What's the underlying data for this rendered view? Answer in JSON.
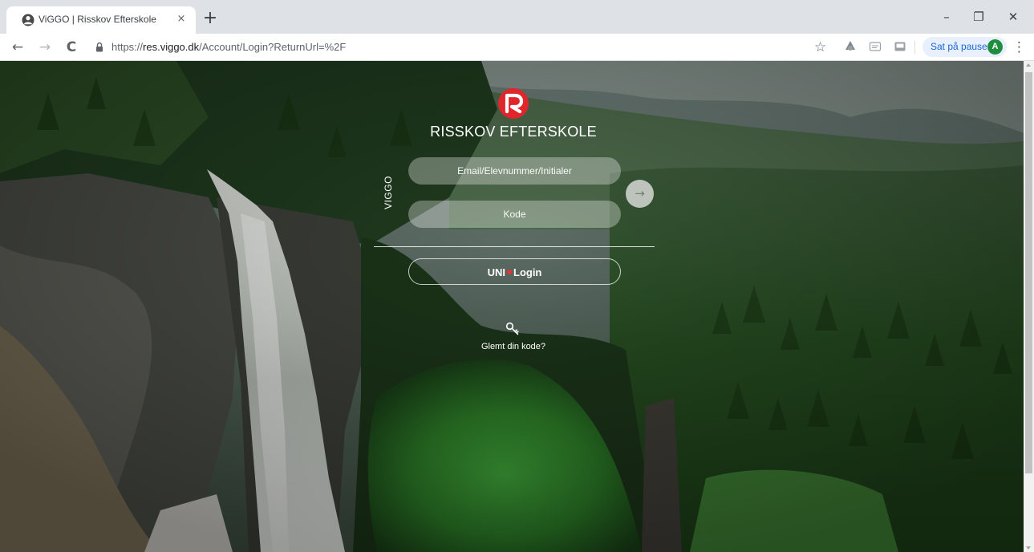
{
  "browser": {
    "tab": {
      "title": "ViGGO | Risskov Efterskole",
      "close_glyph": "×"
    },
    "new_tab_glyph": "+",
    "window_controls": {
      "minimize": "–",
      "restore": "❐",
      "close": "✕"
    },
    "nav": {
      "back": "←",
      "forward": "→",
      "reload": "C"
    },
    "url": {
      "prefix": "https://",
      "host": "res.viggo.dk",
      "path": "/Account/Login?ReturnUrl=%2F"
    },
    "star_glyph": "☆",
    "profile": {
      "status": "Sat på pause",
      "avatar_letter": "A",
      "accent": "#1e8e3e"
    },
    "menu_glyph": "⋮",
    "icons": [
      "favicon-icon",
      "lock-icon",
      "star-icon",
      "extension-icon",
      "puzzle-icon",
      "cast-icon",
      "kebab-menu-icon"
    ]
  },
  "login": {
    "school_name": "RISSKOV EFTERSKOLE",
    "brand_vertical": "VIGGO",
    "email_placeholder": "Email/Elevnummer/Initialer",
    "password_placeholder": "Kode",
    "submit_glyph": "→",
    "unilogin_a": "UNI",
    "unilogin_b": "Login",
    "forgot_text": "Glemt din kode?",
    "colors": {
      "logo_red": "#e0262b",
      "unilogin_dot": "#e8323a",
      "field_bg": "rgba(255,255,255,0.32)"
    }
  }
}
